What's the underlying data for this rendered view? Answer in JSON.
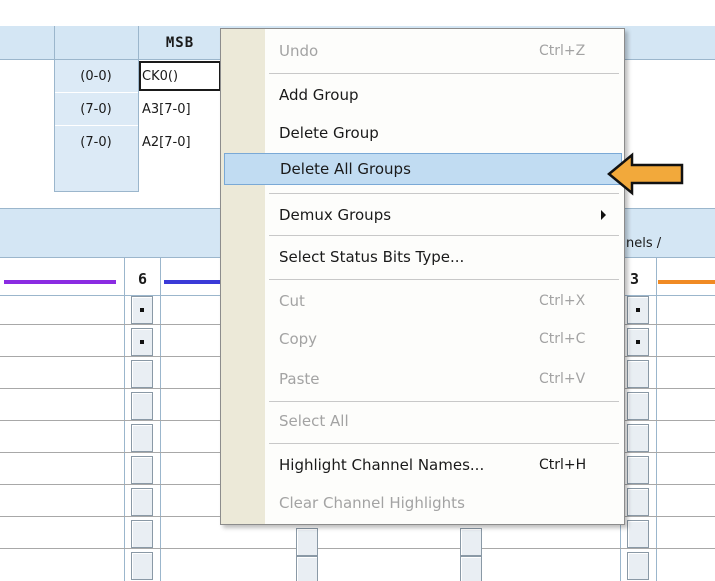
{
  "group_table": {
    "msb_header": "MSB",
    "rows": [
      {
        "range": "(0-0)",
        "name": "CK0()",
        "selected": true
      },
      {
        "range": "(7-0)",
        "name": "A3[7-0]",
        "selected": false
      },
      {
        "range": "(7-0)",
        "name": "A2[7-0]",
        "selected": false
      }
    ]
  },
  "channels_section": {
    "label_fragment": "nels /",
    "columns": [
      {
        "number": "6",
        "line_color": "#3a3ad8"
      },
      {
        "number": "3",
        "line_color": "#f08a24"
      }
    ],
    "left_line_color": "#8a2be2"
  },
  "context_menu": {
    "items": [
      {
        "label": "Undo",
        "shortcut": "Ctrl+Z",
        "disabled": true
      },
      {
        "label": "Add Group",
        "shortcut": "",
        "disabled": false
      },
      {
        "label": "Delete Group",
        "shortcut": "",
        "disabled": false
      },
      {
        "label": "Delete All Groups",
        "shortcut": "",
        "disabled": false,
        "highlighted": true
      },
      {
        "label": "Demux Groups",
        "shortcut": "",
        "disabled": false,
        "submenu": true
      },
      {
        "label": "Select Status Bits Type...",
        "shortcut": "",
        "disabled": false
      },
      {
        "label": "Cut",
        "shortcut": "Ctrl+X",
        "disabled": true
      },
      {
        "label": "Copy",
        "shortcut": "Ctrl+C",
        "disabled": true
      },
      {
        "label": "Paste",
        "shortcut": "Ctrl+V",
        "disabled": true
      },
      {
        "label": "Select All",
        "shortcut": "",
        "disabled": true
      },
      {
        "label": "Highlight Channel Names...",
        "shortcut": "Ctrl+H",
        "disabled": false
      },
      {
        "label": "Clear Channel Highlights",
        "shortcut": "",
        "disabled": true
      }
    ]
  },
  "colors": {
    "header_blue": "#d4e6f4",
    "menu_highlight": "#c1dcf2",
    "arrow_fill": "#f2a93b"
  },
  "icons": {
    "pointer": "orange-left-arrow-icon",
    "submenu": "submenu-arrow-icon"
  }
}
